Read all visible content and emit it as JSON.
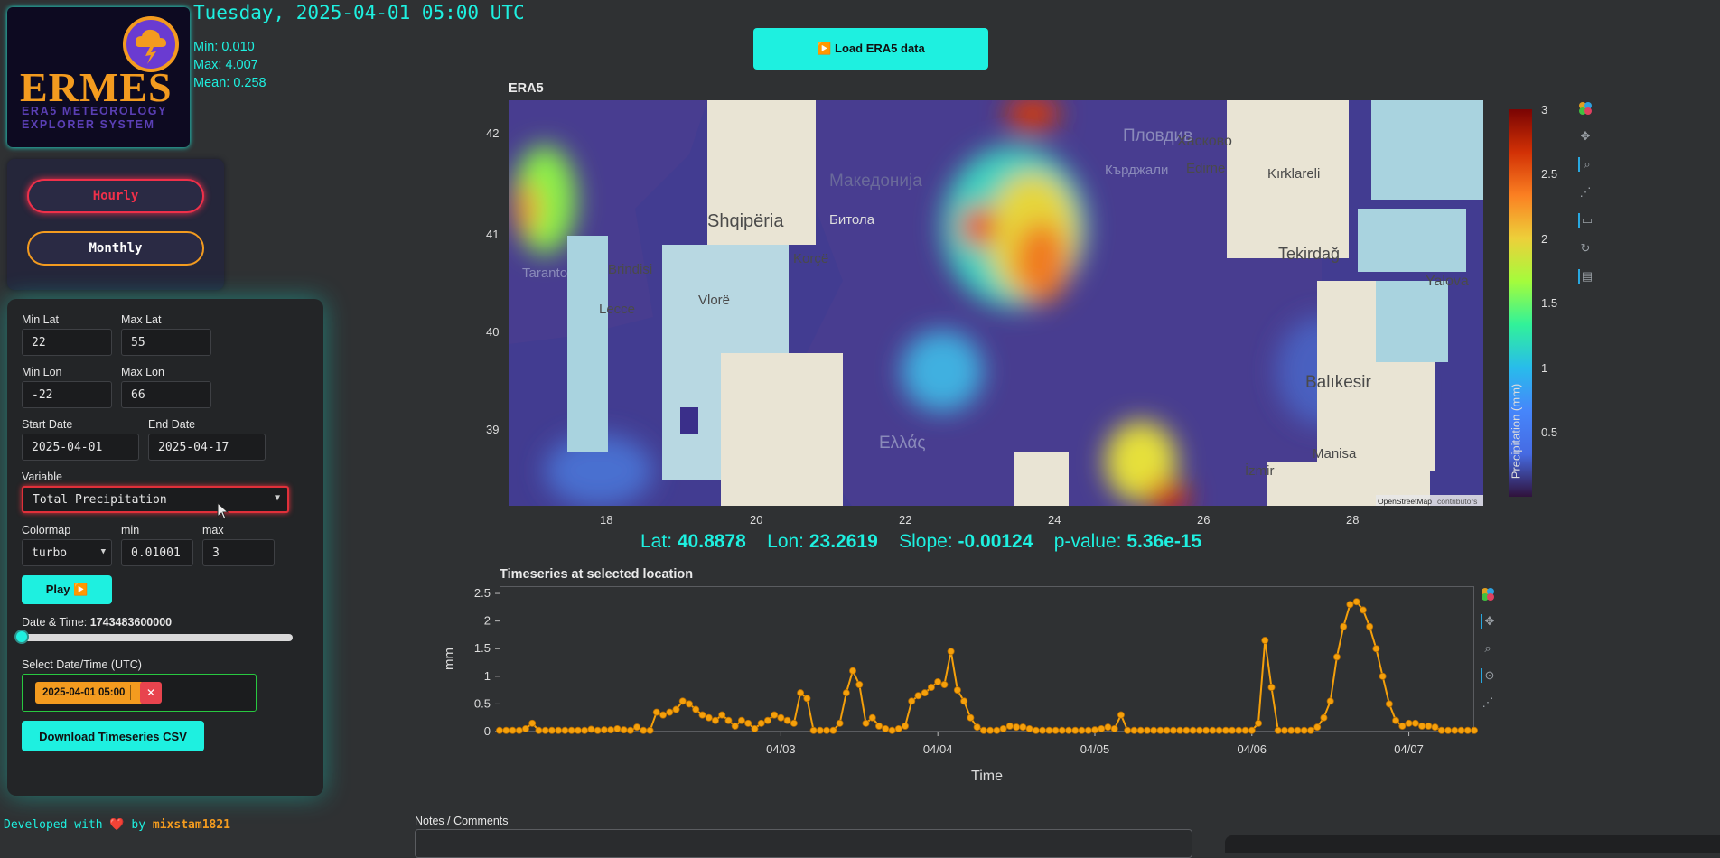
{
  "header": {
    "date_title": "Tuesday, 2025-04-01 05:00 UTC",
    "stats": {
      "min": "Min: 0.010",
      "max": "Max: 4.007",
      "mean": "Mean: 0.258"
    }
  },
  "logo": {
    "name": "ERMES",
    "subtitle_line1": "ERA5 METEOROLOGY",
    "subtitle_line2": "EXPLORER SYSTEM"
  },
  "toggles": {
    "hourly": "Hourly",
    "monthly": "Monthly"
  },
  "form": {
    "min_lat": {
      "label": "Min Lat",
      "value": "22"
    },
    "max_lat": {
      "label": "Max Lat",
      "value": "55"
    },
    "min_lon": {
      "label": "Min Lon",
      "value": "-22"
    },
    "max_lon": {
      "label": "Max Lon",
      "value": "66"
    },
    "start_date": {
      "label": "Start Date",
      "value": "2025-04-01"
    },
    "end_date": {
      "label": "End Date",
      "value": "2025-04-17"
    },
    "variable": {
      "label": "Variable",
      "value": "Total Precipitation"
    },
    "colormap": {
      "label": "Colormap",
      "value": "turbo"
    },
    "cmin": {
      "label": "min",
      "value": "0.01001"
    },
    "cmax": {
      "label": "max",
      "value": "3"
    },
    "play_label": "Play ▶️",
    "datetime_label": "Date & Time:",
    "datetime_value": "1743483600000",
    "slider_fraction": 0.0,
    "select_label": "Select Date/Time (UTC)",
    "selected_tag": "2025-04-01 05:00",
    "remove_glyph": "✕",
    "download_label": "Download Timeseries CSV"
  },
  "footer": {
    "prefix": "Developed with",
    "heart": "❤️",
    "by": "by",
    "author": "mixstam1821"
  },
  "load_button": "▶️ Load ERA5 data",
  "map": {
    "title": "ERA5",
    "y_ticks": [
      "42",
      "41",
      "40",
      "39"
    ],
    "x_ticks": [
      "18",
      "20",
      "22",
      "24",
      "26",
      "28"
    ],
    "colorbar_ticks": [
      "3",
      "2.5",
      "2",
      "1.5",
      "1",
      "0.5"
    ],
    "colorbar_label": "Precipitation (mm)",
    "attribution_link": "OpenStreetMap",
    "attribution_rest": "contributors",
    "place_labels": [
      "Shqipëria",
      "Brindisi",
      "Lecce",
      "Korçë",
      "Vlorë",
      "Битола",
      "Македонија",
      "Пловдив",
      "Кърджали",
      "Хасково",
      "Edirne",
      "Kırklareli",
      "Tekirdağ",
      "Yalova",
      "Balıkesir",
      "Manisa",
      "İzmir",
      "Ελλάς",
      "Taranto"
    ],
    "colors": {
      "colorbar": [
        "#7a0403",
        "#d23105",
        "#fb8022",
        "#edd03a",
        "#a4fc3c",
        "#31f299",
        "#28bceb",
        "#4686fb",
        "#466be3",
        "#30123b"
      ]
    }
  },
  "info": {
    "lat_label": "Lat:",
    "lat": "40.8878",
    "lon_label": "Lon:",
    "lon": "23.2619",
    "slope_label": "Slope:",
    "slope": "-0.00124",
    "p_label": "p-value:",
    "p": "5.36e-15"
  },
  "timeseries": {
    "title": "Timeseries at selected location",
    "notes_label": "Notes / Comments"
  },
  "chart_data": {
    "type": "line",
    "title": "Timeseries at selected location",
    "xlabel": "Time",
    "ylabel": "mm",
    "x_tick_labels": [
      "04/03",
      "04/04",
      "04/05",
      "04/06",
      "04/07"
    ],
    "y_tick_labels": [
      "0",
      "0.5",
      "1",
      "1.5",
      "2",
      "2.5"
    ],
    "ylim": [
      0,
      2.5
    ],
    "x_start": "2025-04-01T05:00",
    "step_hours": 1,
    "series_color": "#f5a00b",
    "values": [
      0.02,
      0.02,
      0.02,
      0.02,
      0.05,
      0.15,
      0.02,
      0.02,
      0.02,
      0.02,
      0.02,
      0.02,
      0.02,
      0.02,
      0.04,
      0.02,
      0.03,
      0.03,
      0.05,
      0.03,
      0.02,
      0.08,
      0.02,
      0.02,
      0.35,
      0.3,
      0.35,
      0.4,
      0.55,
      0.5,
      0.4,
      0.3,
      0.25,
      0.2,
      0.3,
      0.2,
      0.1,
      0.2,
      0.15,
      0.05,
      0.15,
      0.2,
      0.3,
      0.25,
      0.2,
      0.15,
      0.7,
      0.6,
      0.02,
      0.02,
      0.02,
      0.02,
      0.15,
      0.7,
      1.1,
      0.85,
      0.15,
      0.25,
      0.1,
      0.05,
      0.02,
      0.05,
      0.1,
      0.55,
      0.65,
      0.7,
      0.8,
      0.9,
      0.85,
      1.45,
      0.75,
      0.55,
      0.25,
      0.08,
      0.02,
      0.02,
      0.02,
      0.05,
      0.1,
      0.08,
      0.08,
      0.05,
      0.02,
      0.02,
      0.02,
      0.02,
      0.02,
      0.02,
      0.02,
      0.02,
      0.02,
      0.03,
      0.05,
      0.08,
      0.05,
      0.3,
      0.02,
      0.02,
      0.02,
      0.02,
      0.02,
      0.02,
      0.02,
      0.02,
      0.02,
      0.02,
      0.02,
      0.02,
      0.02,
      0.02,
      0.02,
      0.02,
      0.02,
      0.02,
      0.02,
      0.02,
      0.15,
      1.65,
      0.8,
      0.02,
      0.02,
      0.02,
      0.02,
      0.02,
      0.02,
      0.08,
      0.25,
      0.55,
      1.35,
      1.9,
      2.3,
      2.35,
      2.2,
      1.9,
      1.5,
      1.0,
      0.5,
      0.2,
      0.1,
      0.15,
      0.15,
      0.1,
      0.1,
      0.08,
      0.02,
      0.02,
      0.02,
      0.02,
      0.02,
      0.02
    ]
  }
}
